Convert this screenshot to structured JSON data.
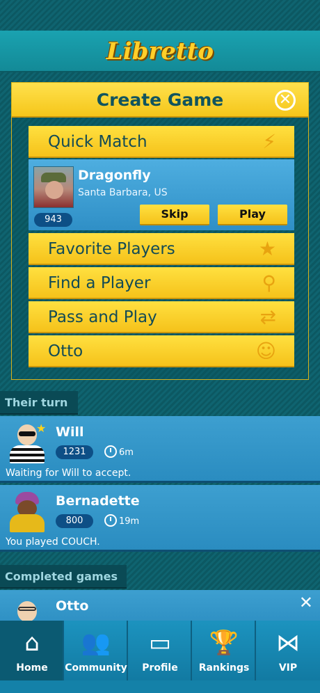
{
  "app": {
    "logo": "Libretto"
  },
  "create_game": {
    "title": "Create Game",
    "close_glyph": "✕",
    "options": [
      {
        "label": "Quick Match",
        "icon": "lightning-icon",
        "glyph": "⚡"
      },
      {
        "label": "Favorite Players",
        "icon": "star-icon",
        "glyph": "★"
      },
      {
        "label": "Find a Player",
        "icon": "magnifier-icon",
        "glyph": "⚲"
      },
      {
        "label": "Pass and Play",
        "icon": "swap-arrows-icon",
        "glyph": "⇄"
      },
      {
        "label": "Otto",
        "icon": "robot-person-icon",
        "glyph": "☺"
      }
    ],
    "quick_match": {
      "name": "Dragonfly",
      "location": "Santa Barbara, US",
      "rating": "943",
      "skip_label": "Skip",
      "play_label": "Play"
    }
  },
  "their_turn": {
    "heading": "Their turn",
    "games": [
      {
        "name": "Will",
        "rating": "1231",
        "time": "6m",
        "status": "Waiting for Will to accept.",
        "favorite": true,
        "avatar_color": "#222222"
      },
      {
        "name": "Bernadette",
        "rating": "800",
        "time": "19m",
        "status": "You played COUCH.",
        "favorite": false,
        "avatar_color": "#8b3a8b"
      }
    ]
  },
  "completed": {
    "heading": "Completed games",
    "games": [
      {
        "name": "Otto",
        "dismiss_glyph": "✕"
      }
    ]
  },
  "tabs": [
    {
      "label": "Home",
      "icon": "house-icon",
      "glyph": "⌂",
      "active": true
    },
    {
      "label": "Community",
      "icon": "people-icon",
      "glyph": "👥",
      "active": false
    },
    {
      "label": "Profile",
      "icon": "id-card-icon",
      "glyph": "▭",
      "active": false
    },
    {
      "label": "Rankings",
      "icon": "trophy-icon",
      "glyph": "🏆",
      "active": false
    },
    {
      "label": "VIP",
      "icon": "bowtie-icon",
      "glyph": "⋈",
      "active": false
    }
  ],
  "colors": {
    "accent": "#f5c61a",
    "teal": "#138a97",
    "row_blue": "#2a8cc0"
  }
}
